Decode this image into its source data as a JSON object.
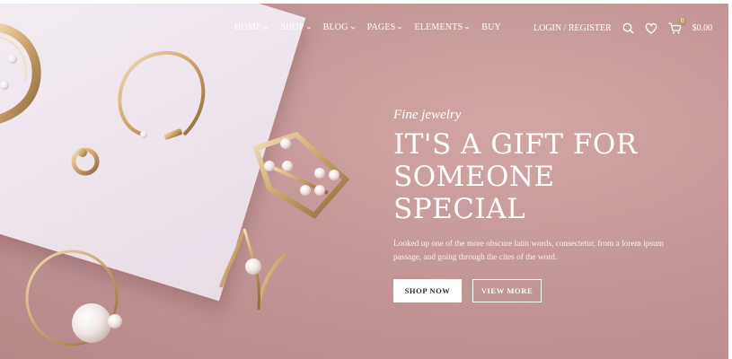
{
  "nav": {
    "menu": [
      {
        "label": "HOME",
        "has_dropdown": true
      },
      {
        "label": "SHOP",
        "has_dropdown": true
      },
      {
        "label": "BLOG",
        "has_dropdown": true
      },
      {
        "label": "PAGES",
        "has_dropdown": true
      },
      {
        "label": "ELEMENTS",
        "has_dropdown": true
      },
      {
        "label": "BUY",
        "has_dropdown": false
      }
    ],
    "login_label": "LOGIN / REGISTER",
    "icons": [
      "search-icon",
      "heart-icon",
      "cart-icon"
    ],
    "cart_count": "0",
    "cart_total": "$0.00"
  },
  "hero": {
    "subtitle": "Fine jewelry",
    "title_line1": "IT'S A GIFT FOR",
    "title_line2": "SOMEONE SPECIAL",
    "description": "Looked up one of the more obscure latin words, consectetur, from a lorem ipsum passage, and going through the cites of the word.",
    "primary_button": "SHOP NOW",
    "secondary_button": "VIEW MORE"
  },
  "colors": {
    "background": "#c49a9b",
    "paper": "#f0e8f0",
    "gold": "#c9a36a",
    "badge": "#b9986a"
  }
}
